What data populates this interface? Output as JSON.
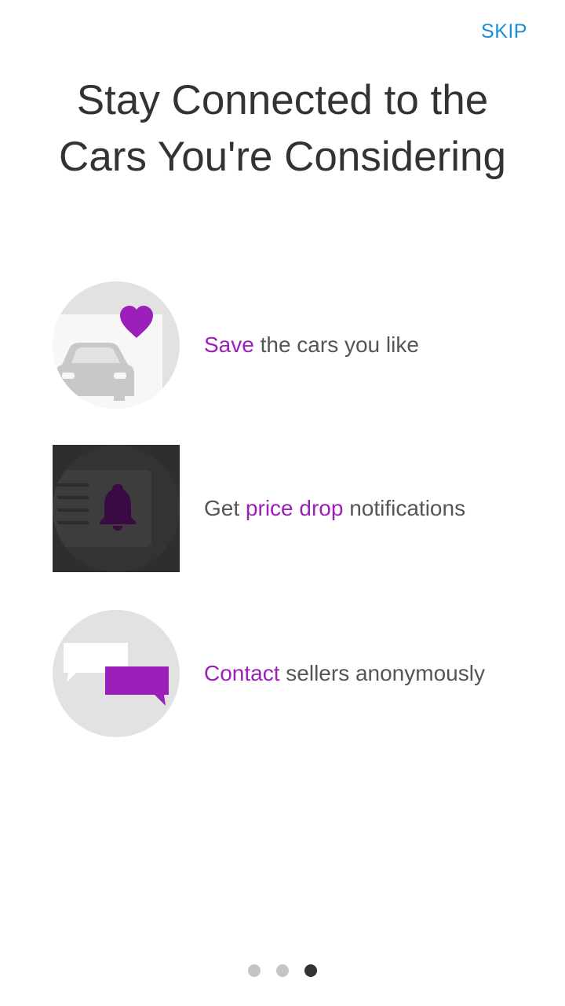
{
  "header": {
    "skip_label": "SKIP",
    "title_line1": "Stay Connected to the",
    "title_line2": "Cars You're Considering"
  },
  "features": [
    {
      "icon": "save-car-heart-icon",
      "accent": "Save",
      "rest": " the cars you like"
    },
    {
      "icon": "bell-notification-icon",
      "prefix": "Get ",
      "accent": "price drop",
      "suffix": " notifications"
    },
    {
      "icon": "chat-bubbles-icon",
      "accent": "Contact",
      "rest": " sellers anonymously"
    }
  ],
  "pager": {
    "count": 3,
    "active_index": 2
  },
  "colors": {
    "accent": "#9b1fb8",
    "skip": "#1a8fd8",
    "title": "#333333",
    "body_text": "#555555"
  }
}
